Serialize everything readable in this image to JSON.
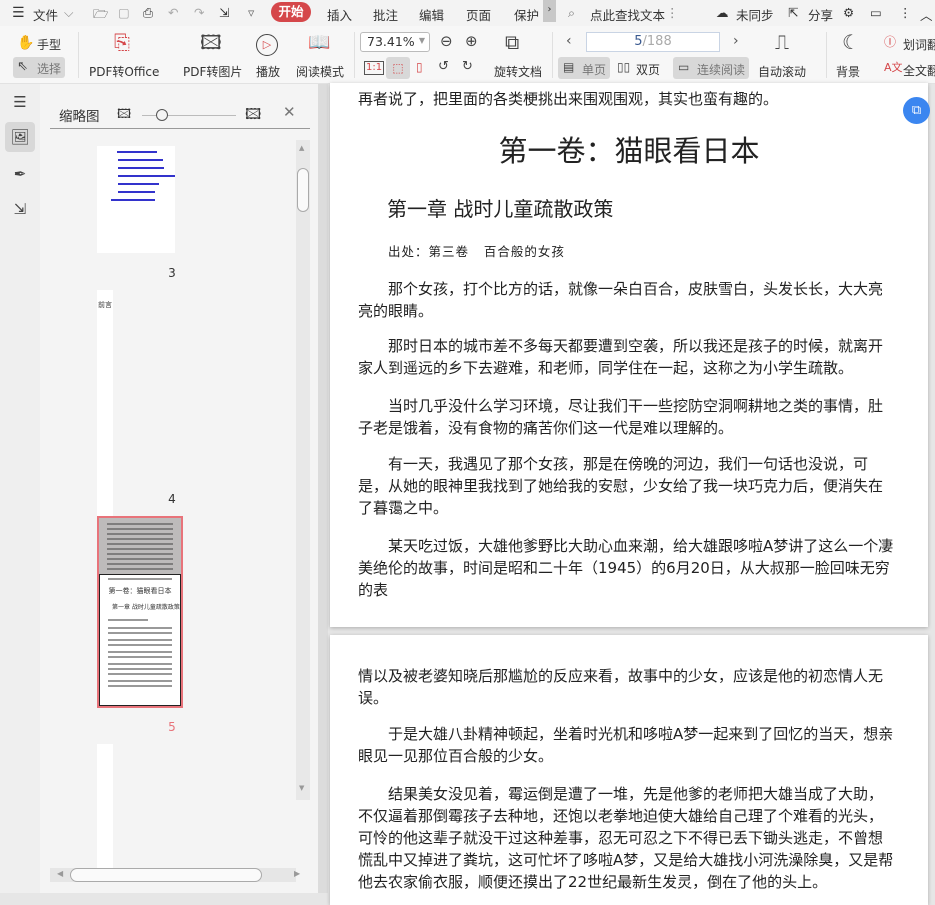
{
  "topbar": {
    "file_menu": "文件",
    "tabs": [
      "开始",
      "插入",
      "批注",
      "编辑",
      "页面",
      "保护"
    ],
    "active_tab": "开始",
    "search_placeholder": "点此查找文本",
    "sync": "未同步",
    "share": "分享"
  },
  "toolbar": {
    "hand": "手型",
    "select": "选择",
    "pdf_to_office": "PDF转Office",
    "pdf_to_image": "PDF转图片",
    "play": "播放",
    "read_mode": "阅读模式",
    "zoom": "73.41%",
    "rotate": "旋转文档",
    "page_current": "5",
    "page_total": "/188",
    "single": "单页",
    "double": "双页",
    "continuous": "连续阅读",
    "auto_scroll": "自动滚动",
    "background": "背景",
    "word_translate": "划词翻",
    "full_translate": "全文翻"
  },
  "thumbnails": {
    "title": "缩略图",
    "pages": [
      "3",
      "4",
      "5"
    ],
    "accent": "#e8737a"
  },
  "document": {
    "page1": {
      "lead": "再者说了，把里面的各类梗挑出来围观围观，其实也蛮有趣的。",
      "volume_title": "第一卷：猫眼看日本",
      "chapter_title": "第一章  战时儿童疏散政策",
      "source": "出处：第三卷   百合般的女孩",
      "paragraphs": [
        "那个女孩，打个比方的话，就像一朵白百合，皮肤雪白，头发长长，大大亮亮的眼睛。",
        "那时日本的城市差不多每天都要遭到空袭，所以我还是孩子的时候，就离开家人到遥远的乡下去避难，和老师，同学住在一起，这称之为小学生疏散。",
        "当时几乎没什么学习环境，尽让我们干一些挖防空洞啊耕地之类的事情，肚子老是饿着，没有食物的痛苦你们这一代是难以理解的。",
        "有一天，我遇见了那个女孩，那是在傍晚的河边，我们一句话也没说，可是，从她的眼神里我找到了她给我的安慰，少女给了我一块巧克力后，便消失在了暮霭之中。",
        "某天吃过饭，大雄他爹野比大助心血来潮，给大雄跟哆啦A梦讲了这么一个凄美绝伦的故事，时间是昭和二十年（1945）的6月20日，从大叔那一脸回味无穷的表"
      ]
    },
    "page2": {
      "paragraphs": [
        "情以及被老婆知晓后那尴尬的反应来看，故事中的少女，应该是他的初恋情人无误。",
        "于是大雄八卦精神顿起，坐着时光机和哆啦A梦一起来到了回忆的当天，想亲眼见一见那位百合般的少女。",
        "结果美女没见着，霉运倒是遭了一堆，先是他爹的老师把大雄当成了大助，不仅逼着那倒霉孩子去种地，还饱以老拳地迫使大雄给自己理了个难看的光头，可怜的他这辈子就没干过这种差事，忍无可忍之下不得已丢下锄头逃走，不曾想慌乱中又掉进了粪坑，这可忙坏了哆啦A梦，又是给大雄找小河洗澡除臭，又是帮他去农家偷衣服，顺便还摸出了22世纪最新生发灵，倒在了他的头上。"
      ]
    }
  }
}
